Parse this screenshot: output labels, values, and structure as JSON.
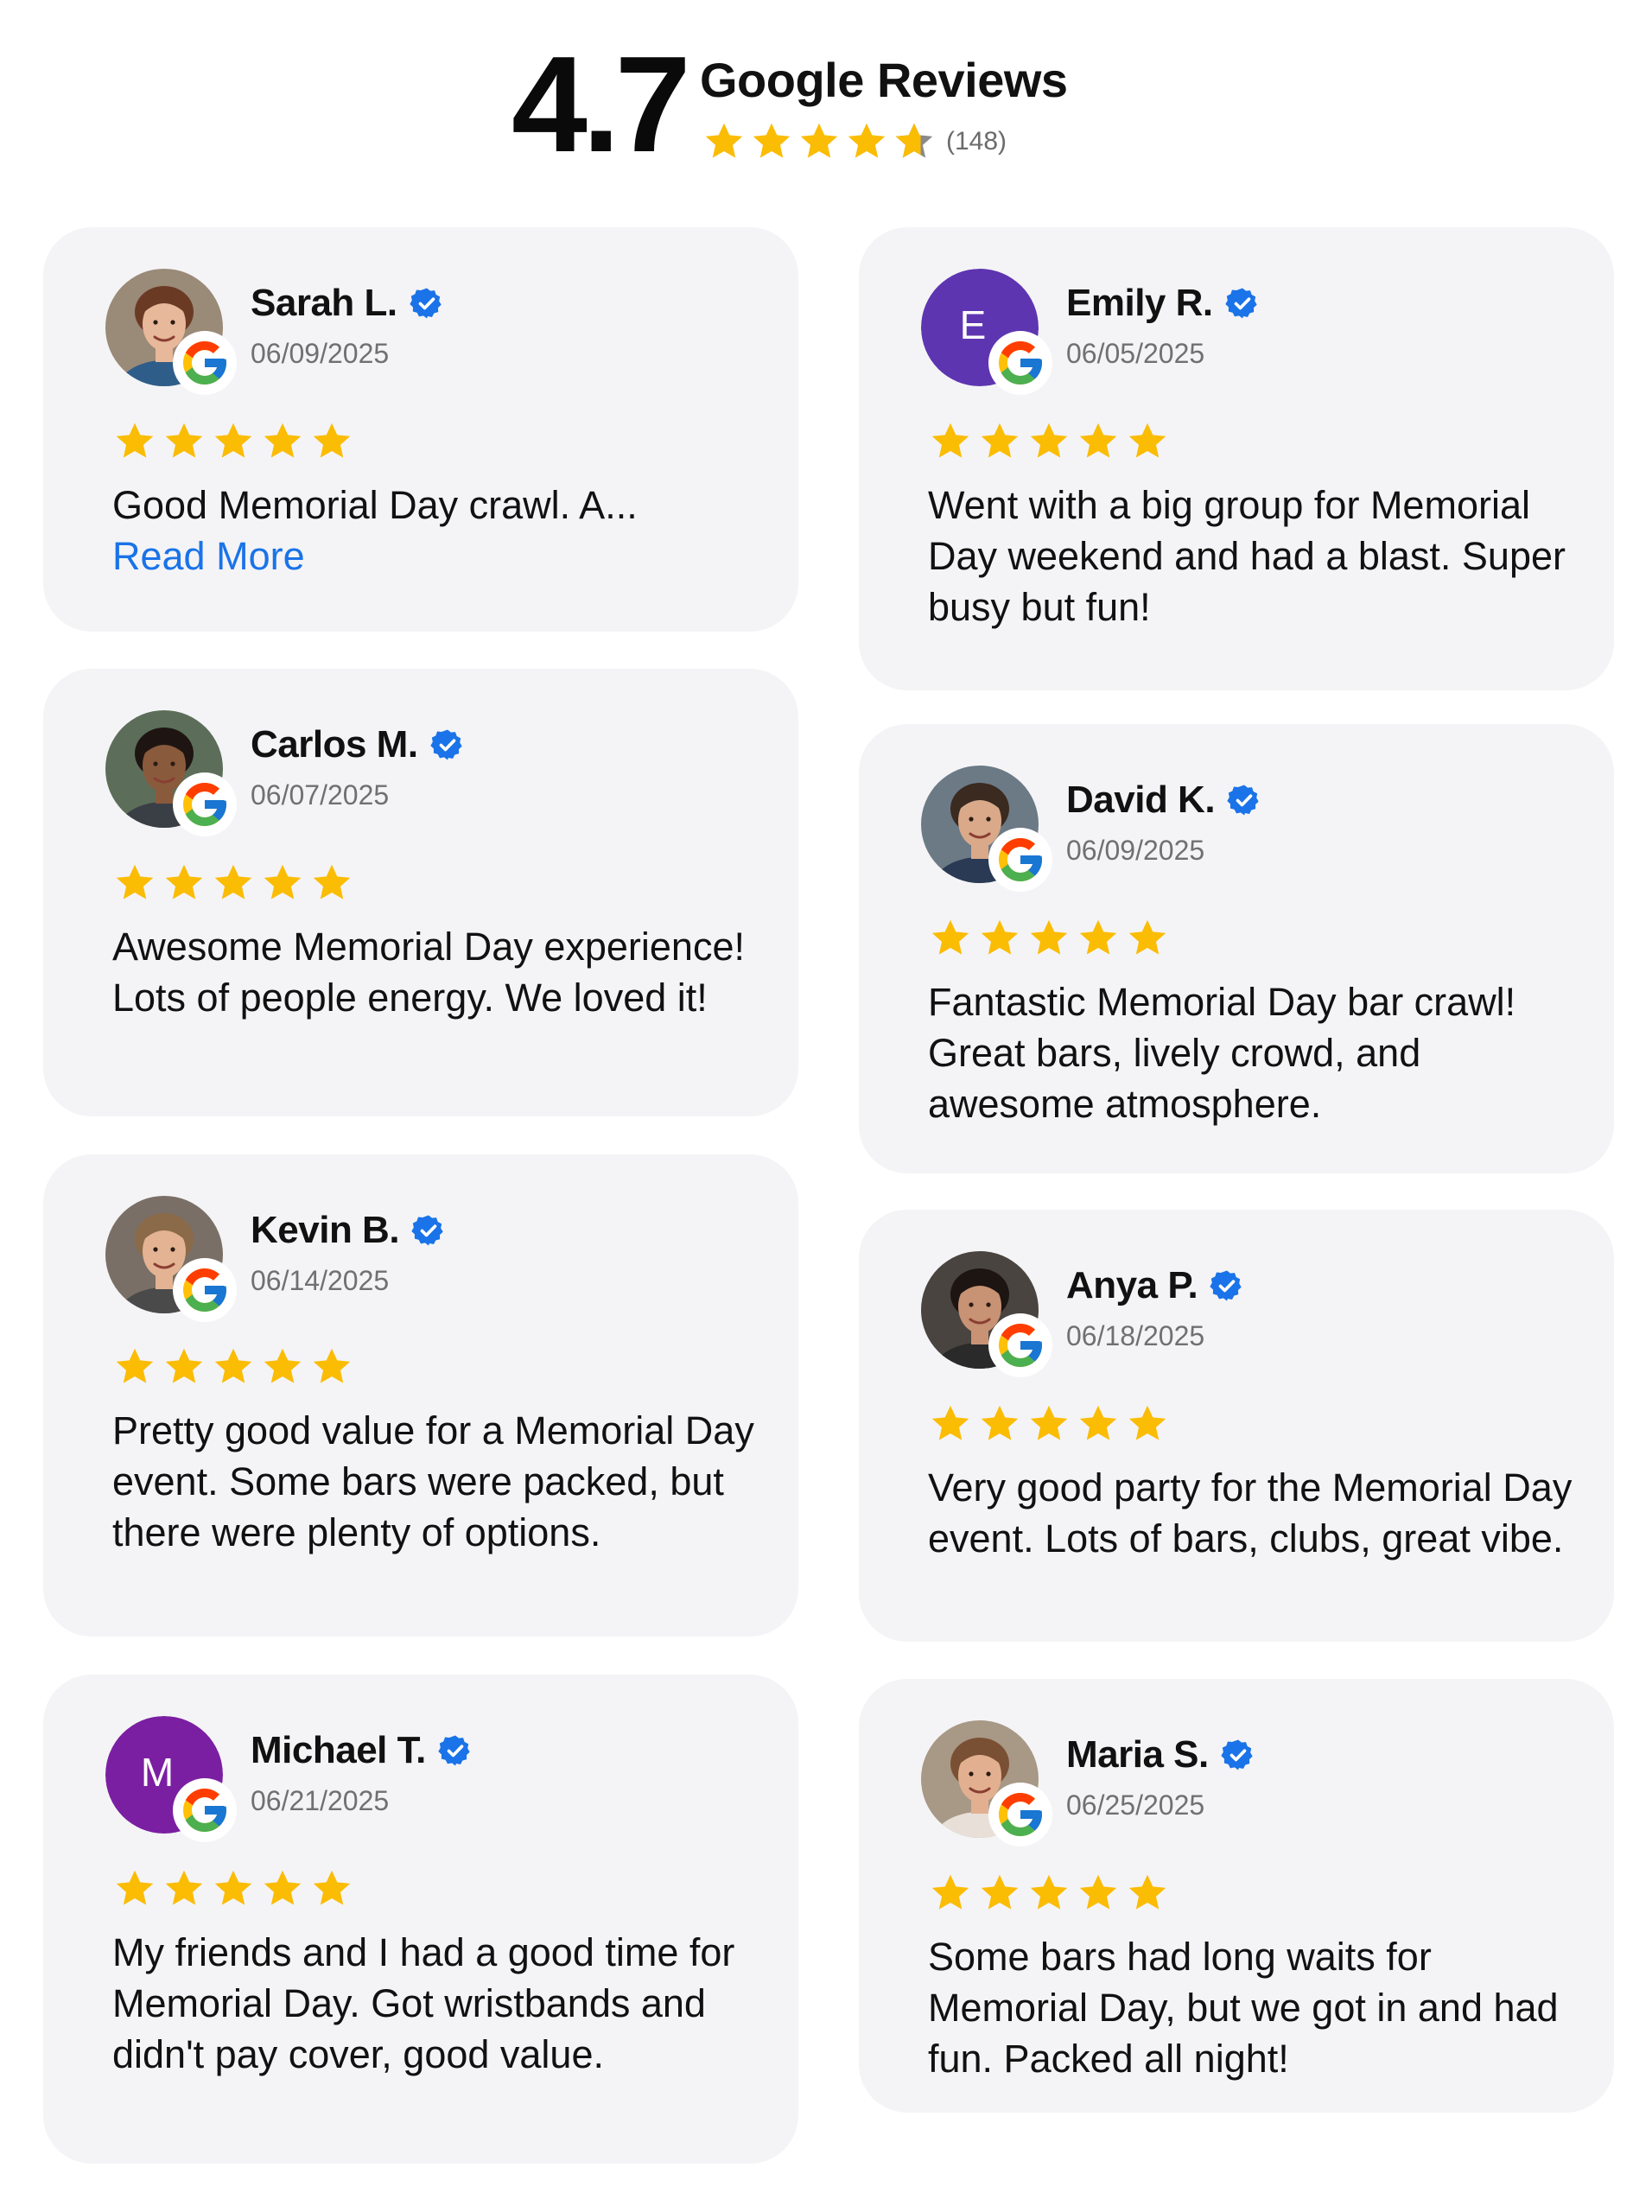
{
  "header": {
    "score": "4.7",
    "title": "Google Reviews",
    "count": "(148)",
    "rating": 4.7
  },
  "colors": {
    "star": "#fbbc04",
    "card_bg": "#f4f4f6",
    "link": "#1a73e8",
    "verified": "#1a73e8"
  },
  "reviews": [
    {
      "name": "Sarah L.",
      "date": "06/09/2025",
      "stars": 5,
      "text": "Good Memorial Day crawl. A...",
      "read_more": "Read More",
      "avatar": "photo"
    },
    {
      "name": "Emily R.",
      "date": "06/05/2025",
      "stars": 5,
      "text": "Went with a big group for Memorial Day weekend and had a blast. Super busy but fun!",
      "avatar": "letter",
      "letter": "E",
      "avatar_color": "#5e35b1"
    },
    {
      "name": "Carlos M.",
      "date": "06/07/2025",
      "stars": 5,
      "text": "Awesome Memorial Day experience! Lots of people energy. We loved it!",
      "avatar": "photo"
    },
    {
      "name": "David K.",
      "date": "06/09/2025",
      "stars": 5,
      "text": "Fantastic Memorial Day bar crawl! Great bars, lively crowd, and awesome atmosphere.",
      "avatar": "photo"
    },
    {
      "name": "Kevin B.",
      "date": "06/14/2025",
      "stars": 5,
      "text": "Pretty good value for a Memorial Day event. Some bars were packed, but there were plenty of options.",
      "avatar": "photo"
    },
    {
      "name": "Anya P.",
      "date": "06/18/2025",
      "stars": 5,
      "text": "Very good party for the Memorial Day event. Lots of bars, clubs, great vibe.",
      "avatar": "photo"
    },
    {
      "name": "Michael T.",
      "date": "06/21/2025",
      "stars": 5,
      "text": "My friends and I had a good time for Memorial Day. Got wristbands and didn't pay cover, good value.",
      "avatar": "letter",
      "letter": "M",
      "avatar_color": "#7b1fa2"
    },
    {
      "name": "Maria S.",
      "date": "06/25/2025",
      "stars": 5,
      "text": "Some bars had long waits for Memorial Day, but we got in and had fun. Packed all night!",
      "avatar": "photo"
    }
  ]
}
